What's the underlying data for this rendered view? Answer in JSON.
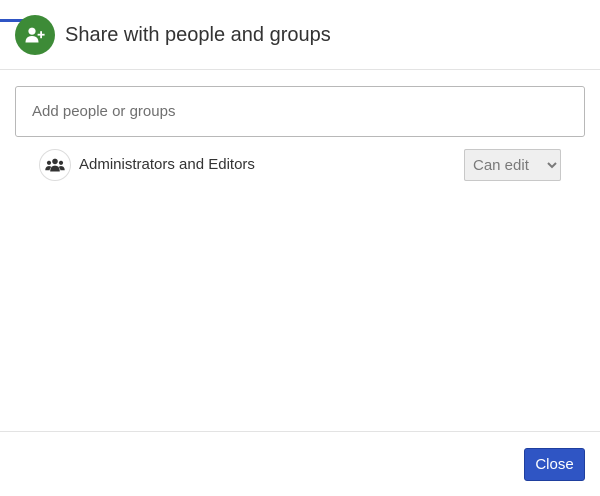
{
  "dialog": {
    "title": "Share with people and groups",
    "header_icon": "add-user-icon",
    "accent_color": "#2f55c4",
    "header_icon_color": "#3d8b37"
  },
  "search": {
    "placeholder": "Add people or groups",
    "value": ""
  },
  "shares": [
    {
      "name": "Administrators and Editors",
      "icon": "users-group-icon",
      "permission": "Can edit"
    }
  ],
  "footer": {
    "close_label": "Close"
  }
}
